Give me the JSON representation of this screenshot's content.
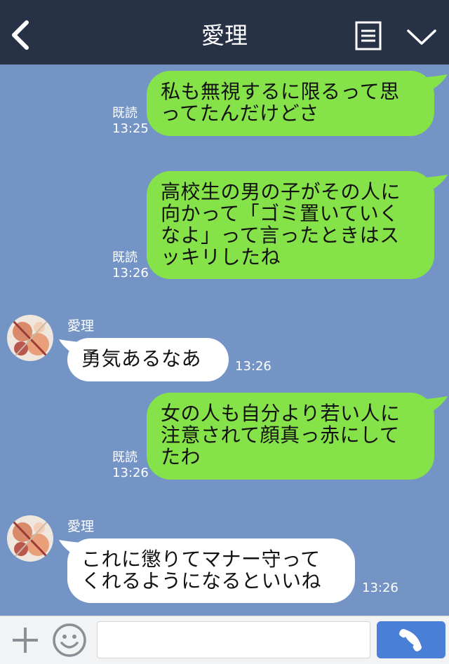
{
  "header": {
    "title": "愛理",
    "back_icon": "back-arrow-icon",
    "notes_icon": "note-list-icon",
    "menu_icon": "chevron-down-icon"
  },
  "messages": [
    {
      "direction": "out",
      "lines": [
        "私も無視するに限るって思",
        "ってたんだけどさ"
      ],
      "read_label": "既読",
      "time": "13:25"
    },
    {
      "direction": "out",
      "lines": [
        "高校生の男の子がその人に",
        "向かって「ゴミ置いていく",
        "なよ」って言ったときはス",
        "ッキリしたね"
      ],
      "read_label": "既読",
      "time": "13:26"
    },
    {
      "direction": "in",
      "sender": "愛理",
      "lines": [
        "勇気あるなあ"
      ],
      "time": "13:26"
    },
    {
      "direction": "out",
      "lines": [
        "女の人も自分より若い人に",
        "注意されて顔真っ赤にして",
        "たわ"
      ],
      "read_label": "既読",
      "time": "13:26"
    },
    {
      "direction": "in",
      "sender": "愛理",
      "lines": [
        "これに懲りてマナー守って",
        "くれるようになるといいね"
      ],
      "time": "13:26"
    }
  ],
  "footer": {
    "add_icon": "plus-icon",
    "sticker_icon": "smiley-icon",
    "input_value": "",
    "call_icon": "phone-icon"
  },
  "colors": {
    "header_bg": "#273246",
    "chat_bg": "#7494c5",
    "outgoing_bubble": "#85e249",
    "incoming_bubble": "#ffffff",
    "call_button": "#4a7fd8"
  }
}
